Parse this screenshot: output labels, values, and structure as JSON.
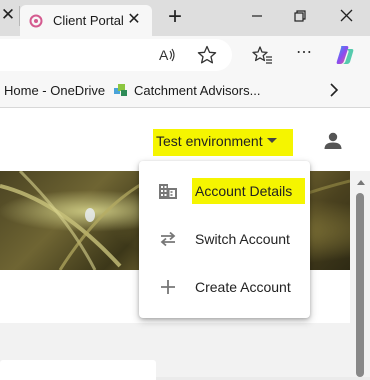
{
  "browser": {
    "tab": {
      "title": "Client Portal"
    },
    "favorites": [
      {
        "label": "Home - OneDrive"
      },
      {
        "label": "Catchment Advisors..."
      }
    ]
  },
  "app": {
    "environment_label": "Test environment",
    "menu": [
      {
        "label": "Account Details",
        "icon": "building-icon"
      },
      {
        "label": "Switch Account",
        "icon": "swap-arrows-icon"
      },
      {
        "label": "Create Account",
        "icon": "plus-icon"
      }
    ]
  },
  "colors": {
    "highlight": "#f5f500",
    "tab_favicon": "#d45a8f"
  }
}
